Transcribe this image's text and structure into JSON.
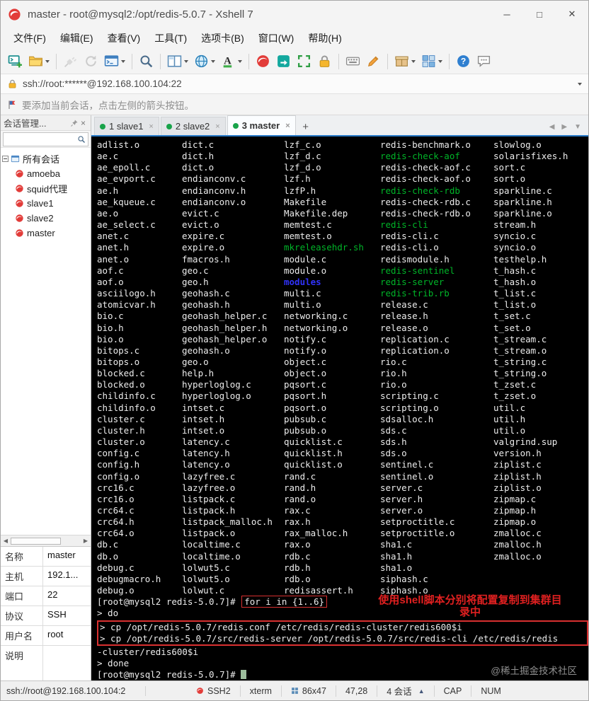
{
  "window": {
    "title": "master - root@mysql2:/opt/redis-5.0.7 - Xshell 7",
    "minimize": "─",
    "maximize": "□",
    "close": "✕"
  },
  "glyphs": {
    "close_tab": "×",
    "plus": "+",
    "left": "◀",
    "right": "▶",
    "down": "▼",
    "up": "▲"
  },
  "menu": {
    "items": [
      "文件(F)",
      "编辑(E)",
      "查看(V)",
      "工具(T)",
      "选项卡(B)",
      "窗口(W)",
      "帮助(H)"
    ]
  },
  "toolbar": {
    "icons": [
      {
        "name": "new-terminal-icon"
      },
      {
        "name": "open-folder-icon",
        "dropdown": true,
        "sep_after": true
      },
      {
        "name": "disconnect-icon",
        "disabled": true
      },
      {
        "name": "reconnect-icon",
        "disabled": true
      },
      {
        "name": "terminal-window-icon",
        "dropdown": true,
        "sep_after": true
      },
      {
        "name": "search-icon",
        "sep_after": true
      },
      {
        "name": "split-pane-icon",
        "dropdown": true
      },
      {
        "name": "globe-icon",
        "dropdown": true
      },
      {
        "name": "font-icon",
        "dropdown": true,
        "sep_after": true
      },
      {
        "name": "xagent-icon"
      },
      {
        "name": "xftp-icon"
      },
      {
        "name": "fullscreen-icon"
      },
      {
        "name": "lock-icon",
        "sep_after": true
      },
      {
        "name": "keyboard-icon"
      },
      {
        "name": "pencil-icon",
        "sep_after": true
      },
      {
        "name": "package-icon",
        "dropdown": true
      },
      {
        "name": "window-grid-icon",
        "dropdown": true,
        "sep_after": true
      },
      {
        "name": "help-icon"
      },
      {
        "name": "chat-icon"
      }
    ]
  },
  "address": {
    "value": "ssh://root:******@192.168.100.104:22"
  },
  "infobar": {
    "text": "要添加当前会话，点击左侧的箭头按钮。"
  },
  "session_panel": {
    "title": "会话管理...",
    "root_label": "所有会话",
    "sessions": [
      "amoeba",
      "squid代理",
      "slave1",
      "slave2",
      "master"
    ]
  },
  "tabs": {
    "items": [
      {
        "label": "1 slave1",
        "active": false
      },
      {
        "label": "2 slave2",
        "active": false
      },
      {
        "label": "3 master",
        "active": true
      }
    ]
  },
  "terminal": {
    "columns": [
      [
        "adlist.o",
        "ae.c",
        "ae_epoll.c",
        "ae_evport.c",
        "ae.h",
        "ae_kqueue.c",
        "ae.o",
        "ae_select.c",
        "anet.c",
        "anet.h",
        "anet.o",
        "aof.c",
        "aof.o",
        "asciilogo.h",
        "atomicvar.h",
        "bio.c",
        "bio.h",
        "bio.o",
        "bitops.c",
        "bitops.o",
        "blocked.c",
        "blocked.o",
        "childinfo.c",
        "childinfo.o",
        "cluster.c",
        "cluster.h",
        "cluster.o",
        "config.c",
        "config.h",
        "config.o",
        "crc16.c",
        "crc16.o",
        "crc64.c",
        "crc64.h",
        "crc64.o",
        "db.c",
        "db.o",
        "debug.c",
        "debugmacro.h",
        "debug.o"
      ],
      [
        "dict.c",
        "dict.h",
        "dict.o",
        "endianconv.c",
        "endianconv.h",
        "endianconv.o",
        "evict.c",
        "evict.o",
        "expire.c",
        "expire.o",
        "fmacros.h",
        "geo.c",
        "geo.h",
        "geohash.c",
        "geohash.h",
        "geohash_helper.c",
        "geohash_helper.h",
        "geohash_helper.o",
        "geohash.o",
        "geo.o",
        "help.h",
        "hyperloglog.c",
        "hyperloglog.o",
        "intset.c",
        "intset.h",
        "intset.o",
        "latency.c",
        "latency.h",
        "latency.o",
        "lazyfree.c",
        "lazyfree.o",
        "listpack.c",
        "listpack.h",
        "listpack_malloc.h",
        "listpack.o",
        "localtime.c",
        "localtime.o",
        "lolwut5.c",
        "lolwut5.o",
        "lolwut.c"
      ],
      [
        "lzf_c.o",
        "lzf_d.c",
        "lzf_d.o",
        "lzf.h",
        "lzfP.h",
        "Makefile",
        "Makefile.dep",
        "memtest.c",
        "memtest.o",
        "mkreleasehdr.sh",
        "module.c",
        "module.o",
        "modules",
        "multi.c",
        "multi.o",
        "networking.c",
        "networking.o",
        "notify.c",
        "notify.o",
        "object.c",
        "object.o",
        "pqsort.c",
        "pqsort.h",
        "pqsort.o",
        "pubsub.c",
        "pubsub.o",
        "quicklist.c",
        "quicklist.h",
        "quicklist.o",
        "rand.c",
        "rand.h",
        "rand.o",
        "rax.c",
        "rax.h",
        "rax_malloc.h",
        "rax.o",
        "rdb.c",
        "rdb.h",
        "rdb.o",
        "redisassert.h"
      ],
      [
        "redis-benchmark.o",
        "redis-check-aof",
        "redis-check-aof.c",
        "redis-check-aof.o",
        "redis-check-rdb",
        "redis-check-rdb.c",
        "redis-check-rdb.o",
        "redis-cli",
        "redis-cli.c",
        "redis-cli.o",
        "redismodule.h",
        "redis-sentinel",
        "redis-server",
        "redis-trib.rb",
        "release.c",
        "release.h",
        "release.o",
        "replication.c",
        "replication.o",
        "rio.c",
        "rio.h",
        "rio.o",
        "scripting.c",
        "scripting.o",
        "sdsalloc.h",
        "sds.c",
        "sds.h",
        "sds.o",
        "sentinel.c",
        "sentinel.o",
        "server.c",
        "server.h",
        "server.o",
        "setproctitle.c",
        "setproctitle.o",
        "sha1.c",
        "sha1.h",
        "sha1.o",
        "siphash.c",
        "siphash.o"
      ],
      [
        "slowlog.o",
        "solarisfixes.h",
        "sort.c",
        "sort.o",
        "sparkline.c",
        "sparkline.h",
        "sparkline.o",
        "stream.h",
        "syncio.c",
        "syncio.o",
        "testhelp.h",
        "t_hash.c",
        "t_hash.o",
        "t_list.c",
        "t_list.o",
        "t_set.c",
        "t_set.o",
        "t_stream.c",
        "t_stream.o",
        "t_string.c",
        "t_string.o",
        "t_zset.c",
        "t_zset.o",
        "util.c",
        "util.h",
        "util.o",
        "valgrind.sup",
        "version.h",
        "ziplist.c",
        "ziplist.h",
        "ziplist.o",
        "zipmap.c",
        "zipmap.h",
        "zipmap.o",
        "zmalloc.c",
        "zmalloc.h",
        "zmalloc.o"
      ]
    ],
    "green_files": [
      "mkreleasehdr.sh",
      "redis-check-aof",
      "redis-check-rdb",
      "redis-cli",
      "redis-sentinel",
      "redis-server",
      "redis-trib.rb"
    ],
    "blue_files": [
      "modules"
    ],
    "cmd": {
      "l1_prefix": "[root@mysql2 redis-5.0.7]# ",
      "l1_boxed": "for i in {1..6}",
      "l2": "> do",
      "l3": "> cp /opt/redis-5.0.7/redis.conf /etc/redis/redis-cluster/redis600$i",
      "l4": "> cp /opt/redis-5.0.7/src/redis-server /opt/redis-5.0.7/src/redis-cli /etc/redis/redis",
      "l5": "-cluster/redis600$i",
      "l6": "> done",
      "l7": "[root@mysql2 redis-5.0.7]# ",
      "annotation1": "使用shell脚本分别将配置复制到集群目",
      "annotation2": "录中"
    }
  },
  "properties": [
    {
      "label": "名称",
      "value": "master"
    },
    {
      "label": "主机",
      "value": "192.1..."
    },
    {
      "label": "端口",
      "value": "22"
    },
    {
      "label": "协议",
      "value": "SSH"
    },
    {
      "label": "用户名",
      "value": "root"
    },
    {
      "label": "说明",
      "value": ""
    }
  ],
  "statusbar": {
    "address": "ssh://root@192.168.100.104:2",
    "items": [
      {
        "key": "protocol",
        "label": "SSH2",
        "icon": "connection"
      },
      {
        "key": "terminal-type",
        "label": "xterm"
      },
      {
        "key": "screen-size",
        "label": "86x47",
        "icon": "grid"
      },
      {
        "key": "cursor-position",
        "label": "47,28"
      },
      {
        "key": "session-count",
        "label": "4 会话",
        "suffix": "▲"
      },
      {
        "key": "caps-lock",
        "label": "CAP"
      },
      {
        "key": "num-lock",
        "label": "NUM"
      }
    ]
  },
  "watermark": "@稀土掘金技术社区"
}
